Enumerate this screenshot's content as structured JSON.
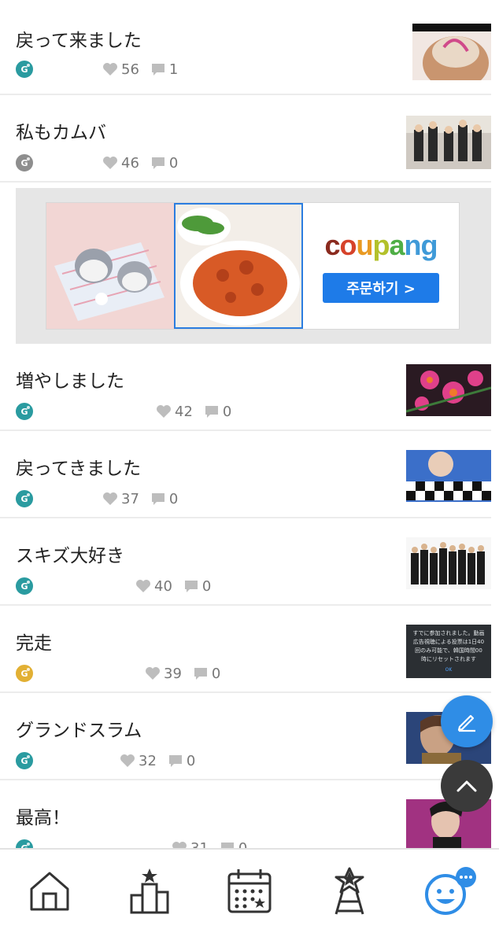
{
  "posts": [
    {
      "title": "戻って来ました",
      "likes": "56",
      "comments": "1",
      "badge": "teal"
    },
    {
      "title": "私もカムバ",
      "likes": "46",
      "comments": "0",
      "badge": "gray"
    },
    {
      "title": "増やしました",
      "likes": "42",
      "comments": "0",
      "badge": "teal"
    },
    {
      "title": "戻ってきました",
      "likes": "37",
      "comments": "0",
      "badge": "teal"
    },
    {
      "title": "スキズ大好き",
      "likes": "40",
      "comments": "0",
      "badge": "teal"
    },
    {
      "title": "完走",
      "likes": "39",
      "comments": "0",
      "badge": "gold"
    },
    {
      "title": "グランドスラム",
      "likes": "32",
      "comments": "0",
      "badge": "teal"
    },
    {
      "title": "最高！",
      "likes": "31",
      "comments": "0",
      "badge": "teal"
    }
  ],
  "badge_letter": "G",
  "ad": {
    "brand": "coupang",
    "cta": "주문하기 >",
    "popup_text": "すでに参加されました。動画広告視聴による投票は1日40回のみ可能で、韓国時間00時にリセットされます",
    "popup_ok": "OK"
  },
  "colors": {
    "accent": "#2f8de6",
    "badge_teal": "#2a9ba0",
    "badge_gold": "#e2b034",
    "ad_cta": "#1e7be8"
  },
  "tabs": [
    {
      "icon": "home-icon"
    },
    {
      "icon": "chart-icon"
    },
    {
      "icon": "calendar-icon"
    },
    {
      "icon": "idol-tower-icon"
    },
    {
      "icon": "community-icon"
    }
  ]
}
